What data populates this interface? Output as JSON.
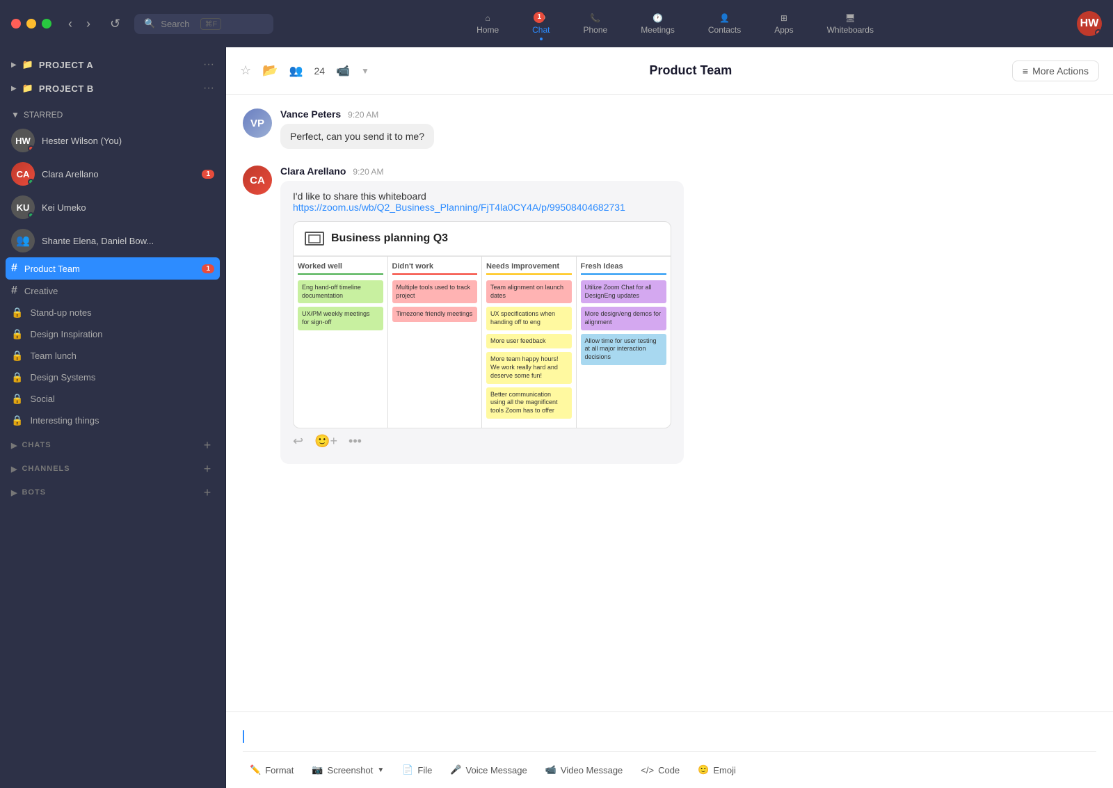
{
  "titlebar": {
    "search_placeholder": "Search",
    "shortcut": "⌘F"
  },
  "topnav": {
    "items": [
      {
        "id": "home",
        "label": "Home",
        "icon": "🏠",
        "badge": null,
        "active": false
      },
      {
        "id": "chat",
        "label": "Chat",
        "icon": "💬",
        "badge": "1",
        "active": true
      },
      {
        "id": "phone",
        "label": "Phone",
        "icon": "📞",
        "badge": null,
        "active": false
      },
      {
        "id": "meetings",
        "label": "Meetings",
        "icon": "🕐",
        "badge": null,
        "active": false
      },
      {
        "id": "contacts",
        "label": "Contacts",
        "icon": "👤",
        "badge": null,
        "active": false
      },
      {
        "id": "apps",
        "label": "Apps",
        "icon": "⊞",
        "badge": null,
        "active": false
      },
      {
        "id": "whiteboards",
        "label": "Whiteboards",
        "icon": "🖥",
        "badge": null,
        "active": false
      }
    ]
  },
  "sidebar": {
    "folders": [
      {
        "label": "PROJECT A",
        "icon": "📁"
      },
      {
        "label": "PROJECT B",
        "icon": "📁"
      }
    ],
    "starred_label": "STARRED",
    "contacts": [
      {
        "name": "Hester Wilson (You)",
        "status": "red",
        "badge": null
      },
      {
        "name": "Clara Arellano",
        "status": "online",
        "badge": "1"
      },
      {
        "name": "Kei Umeko",
        "status": "online",
        "badge": null
      },
      {
        "name": "Shante Elena, Daniel Bow...",
        "status": null,
        "badge": null
      }
    ],
    "channels": [
      {
        "name": "Product Team",
        "type": "hash",
        "active": true,
        "badge": "1"
      },
      {
        "name": "Creative",
        "type": "hash",
        "active": false,
        "badge": null
      },
      {
        "name": "Stand-up notes",
        "type": "lock",
        "active": false
      },
      {
        "name": "Design Inspiration",
        "type": "lock",
        "active": false
      },
      {
        "name": "Team lunch",
        "type": "lock",
        "active": false
      },
      {
        "name": "Design Systems",
        "type": "lock",
        "active": false
      },
      {
        "name": "Social",
        "type": "lock",
        "active": false
      },
      {
        "name": "Interesting things",
        "type": "lock",
        "active": false
      }
    ],
    "sections": [
      {
        "label": "CHATS"
      },
      {
        "label": "CHANNELS"
      },
      {
        "label": "BOTS"
      }
    ]
  },
  "chat": {
    "title": "Product Team",
    "members": "24",
    "actions": {
      "more": "More Actions"
    },
    "messages": [
      {
        "id": "msg1",
        "sender": "Vance Peters",
        "time": "9:20 AM",
        "text": "Perfect, can you send it to me?"
      },
      {
        "id": "msg2",
        "sender": "Clara Arellano",
        "time": "9:20 AM",
        "text": "I'd like to share this whiteboard",
        "link": "https://zoom.us/wb/Q2_Business_Planning/FjT4la0CY4A/p/99508404682731",
        "whiteboard": {
          "title": "Business planning Q3",
          "columns": [
            {
              "header": "Worked well",
              "color": "green",
              "stickies": [
                {
                  "color": "green",
                  "text": "Eng hand-off timeline documentation"
                },
                {
                  "color": "green",
                  "text": "UX/PM weekly meetings for sign-off"
                }
              ]
            },
            {
              "header": "Didn't work",
              "color": "red",
              "stickies": [
                {
                  "color": "red",
                  "text": "Multiple tools used to track project"
                },
                {
                  "color": "red",
                  "text": "Timezone friendly meetings"
                }
              ]
            },
            {
              "header": "Needs Improvement",
              "color": "yellow",
              "stickies": [
                {
                  "color": "red",
                  "text": "Team alignment on launch dates"
                },
                {
                  "color": "yellow",
                  "text": "UX specifications when handing off to eng"
                },
                {
                  "color": "yellow",
                  "text": "More user feedback"
                },
                {
                  "color": "yellow",
                  "text": "More team happy hours! We work really hard and deserve some fun!"
                },
                {
                  "color": "yellow",
                  "text": "Better communication using all the magnificent tools Zoom has to offer"
                }
              ]
            },
            {
              "header": "Fresh Ideas",
              "color": "blue",
              "stickies": [
                {
                  "color": "purple",
                  "text": "Utilize Zoom Chat for all DesignEng updates"
                },
                {
                  "color": "purple",
                  "text": "More design/eng demos for alignment"
                },
                {
                  "color": "blue",
                  "text": "Allow time for user testing at all major interaction decisions"
                }
              ]
            }
          ]
        }
      }
    ],
    "message_actions": [
      {
        "icon": "↩",
        "label": "reply"
      },
      {
        "icon": "🙂",
        "label": "emoji"
      },
      {
        "icon": "•••",
        "label": "more"
      }
    ]
  },
  "toolbar": {
    "format_label": "Format",
    "screenshot_label": "Screenshot",
    "file_label": "File",
    "voice_label": "Voice Message",
    "video_label": "Video Message",
    "code_label": "Code",
    "emoji_label": "Emoji"
  }
}
